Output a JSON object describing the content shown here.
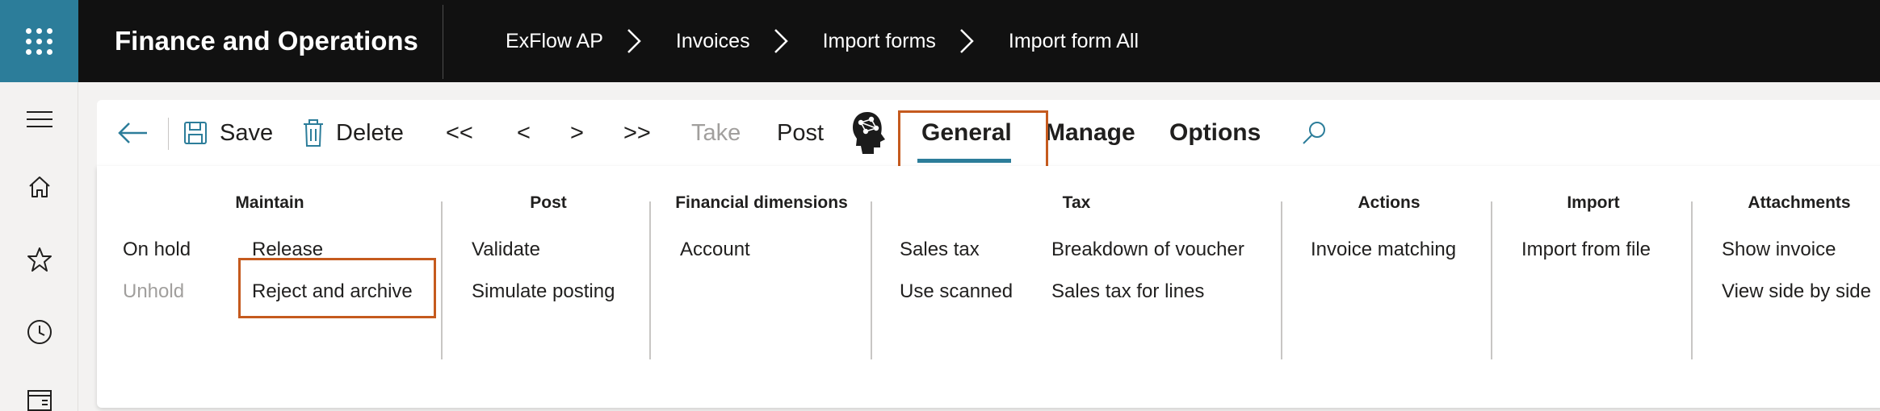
{
  "app": {
    "title": "Finance and Operations"
  },
  "breadcrumb": [
    "ExFlow AP",
    "Invoices",
    "Import forms",
    "Import form All"
  ],
  "nav": {
    "icons": [
      "menu-icon",
      "home-icon",
      "star-icon",
      "clock-icon",
      "workspace-icon"
    ]
  },
  "toolbar": {
    "save": "Save",
    "delete": "Delete",
    "first": "<<",
    "prev": "<",
    "next": ">",
    "last": ">>",
    "take": "Take",
    "post": "Post",
    "tabs": {
      "general": "General",
      "manage": "Manage",
      "options": "Options"
    }
  },
  "ribbon": {
    "maintain": {
      "title": "Maintain",
      "on_hold": "On hold",
      "unhold": "Unhold",
      "release": "Release",
      "reject_archive": "Reject and archive"
    },
    "post": {
      "title": "Post",
      "validate": "Validate",
      "simulate": "Simulate posting"
    },
    "financial_dimensions": {
      "title": "Financial dimensions",
      "account": "Account"
    },
    "tax": {
      "title": "Tax",
      "sales_tax": "Sales tax",
      "use_scanned": "Use scanned",
      "breakdown": "Breakdown of voucher",
      "sales_tax_lines": "Sales tax for lines"
    },
    "actions": {
      "title": "Actions",
      "invoice_matching": "Invoice matching"
    },
    "import": {
      "title": "Import",
      "import_file": "Import from file"
    },
    "attachments": {
      "title": "Attachments",
      "show_invoice": "Show invoice",
      "side_by_side": "View side by side"
    }
  },
  "colors": {
    "accent": "#2c7d9a",
    "highlight": "#c55a1e",
    "topbar": "#111111"
  }
}
